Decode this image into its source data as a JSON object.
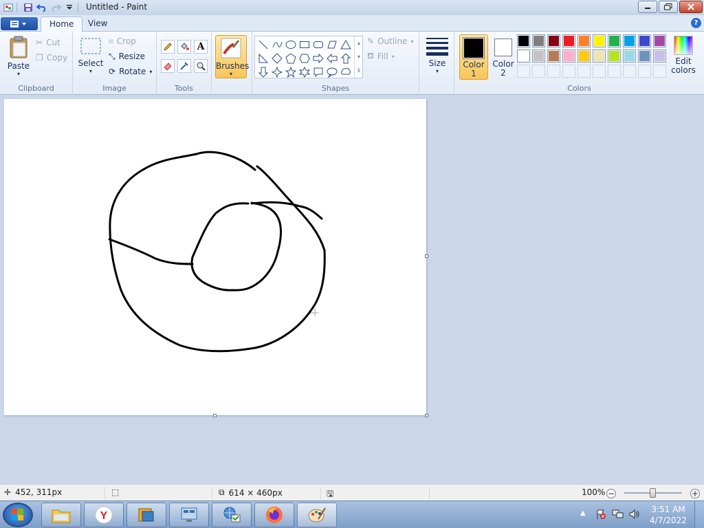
{
  "window": {
    "title": "Untitled - Paint"
  },
  "tabs": [
    {
      "label": "Home",
      "active": true
    },
    {
      "label": "View",
      "active": false
    }
  ],
  "clipboard": {
    "group_label": "Clipboard",
    "paste_label": "Paste",
    "cut_label": "Cut",
    "copy_label": "Copy"
  },
  "image": {
    "group_label": "Image",
    "select_label": "Select",
    "crop_label": "Crop",
    "resize_label": "Resize",
    "rotate_label": "Rotate"
  },
  "tools": {
    "group_label": "Tools",
    "items": [
      "pencil-icon",
      "fill-icon",
      "text-icon",
      "eraser-icon",
      "color-picker-icon",
      "magnifier-icon"
    ]
  },
  "brushes": {
    "label": "Brushes"
  },
  "shapes": {
    "group_label": "Shapes",
    "outline_label": "Outline",
    "fill_label": "Fill"
  },
  "size": {
    "label": "Size"
  },
  "colors": {
    "group_label": "Colors",
    "color1_label": "Color",
    "color1_num": "1",
    "color2_label": "Color",
    "color2_num": "2",
    "edit_label": "Edit",
    "edit_label2": "colors",
    "color1": "#000000",
    "color2": "#ffffff",
    "palette_row1": [
      "#000000",
      "#7f7f7f",
      "#880015",
      "#ed1c24",
      "#ff7f27",
      "#fff200",
      "#22b14c",
      "#00a2e8",
      "#3f48cc",
      "#a349a4"
    ],
    "palette_row2": [
      "#ffffff",
      "#c3c3c3",
      "#b97a57",
      "#ffaec9",
      "#ffc90e",
      "#efe4b0",
      "#b5e61d",
      "#99d9ea",
      "#7092be",
      "#c8bfe7"
    ]
  },
  "status": {
    "cursor_pos": "452, 311px",
    "canvas_size": "614 × 460px",
    "zoom": "100%"
  },
  "taskbar": {
    "time": "3:51 AM",
    "date": "4/7/2022"
  }
}
